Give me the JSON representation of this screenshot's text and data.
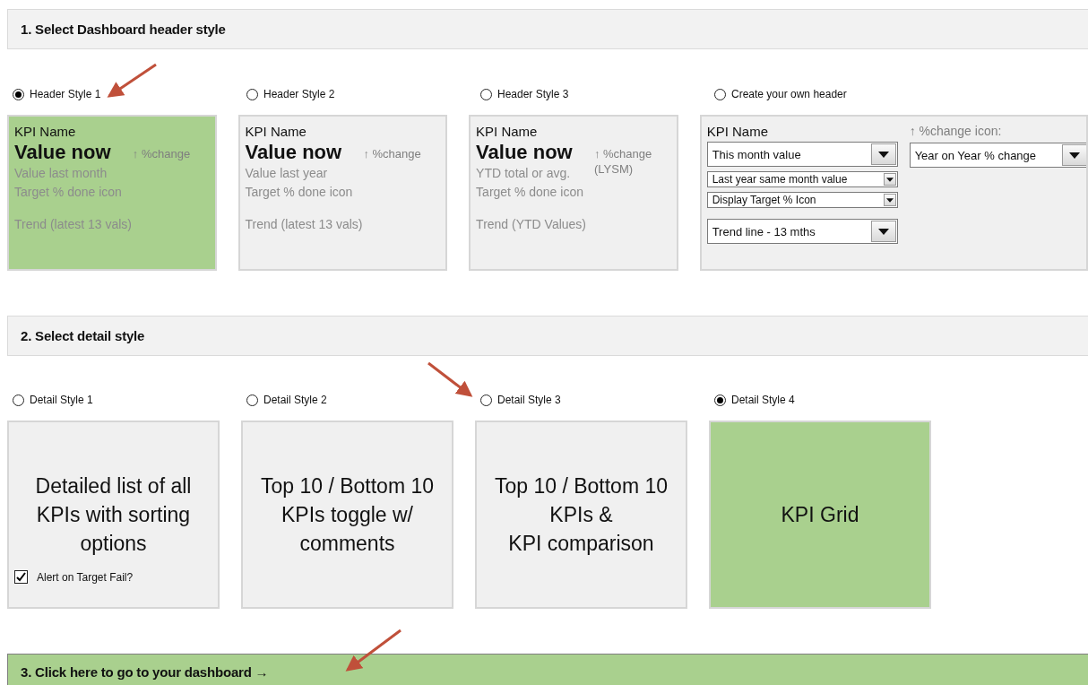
{
  "header_section": {
    "title": "1. Select Dashboard header style",
    "options": [
      {
        "kind": "preview",
        "label": "Header Style 1",
        "selected": true,
        "kpi_name": "KPI Name",
        "value": "Value now",
        "change": [
          "↑ %change"
        ],
        "lines": [
          "Value last month",
          "Target % done icon"
        ],
        "trend": "Trend (latest 13 vals)"
      },
      {
        "kind": "preview",
        "label": "Header Style 2",
        "selected": false,
        "kpi_name": "KPI Name",
        "value": "Value now",
        "change": [
          "↑ %change"
        ],
        "lines": [
          "Value last year",
          "Target % done icon"
        ],
        "trend": "Trend (latest 13 vals)"
      },
      {
        "kind": "preview",
        "label": "Header Style 3",
        "selected": false,
        "kpi_name": "KPI Name",
        "value": "Value now",
        "change": [
          "↑ %change",
          "(LYSM)"
        ],
        "lines": [
          "YTD total or avg.",
          "Target % done icon"
        ],
        "trend": "Trend (YTD Values)"
      },
      {
        "kind": "custom",
        "label": "Create your own header",
        "selected": false,
        "kpi_name": "KPI Name",
        "dropdowns": [
          {
            "value": "This month value",
            "kind": "large"
          },
          {
            "value": "Last year same month value",
            "kind": "small"
          },
          {
            "value": "Display Target % Icon",
            "kind": "small"
          },
          {
            "value": "Trend line - 13 mths",
            "kind": "large"
          }
        ],
        "change_label": "↑ %change icon:",
        "change_dropdown": {
          "value": "Year on Year % change",
          "kind": "large"
        }
      }
    ]
  },
  "detail_section": {
    "title": "2. Select detail style",
    "options": [
      {
        "label": "Detail Style 1",
        "selected": false,
        "text": "Detailed list of all KPIs with sorting options",
        "checkbox": {
          "label": "Alert on Target Fail?",
          "checked": true
        }
      },
      {
        "label": "Detail Style 2",
        "selected": false,
        "text": "Top 10 / Bottom 10 KPIs toggle w/ comments"
      },
      {
        "label": "Detail Style 3",
        "selected": false,
        "text": "Top 10 / Bottom 10\nKPIs &\nKPI comparison"
      },
      {
        "label": "Detail Style 4",
        "selected": true,
        "text": "KPI Grid"
      }
    ]
  },
  "go_link": {
    "label": "3. Click here to go to your dashboard →"
  }
}
